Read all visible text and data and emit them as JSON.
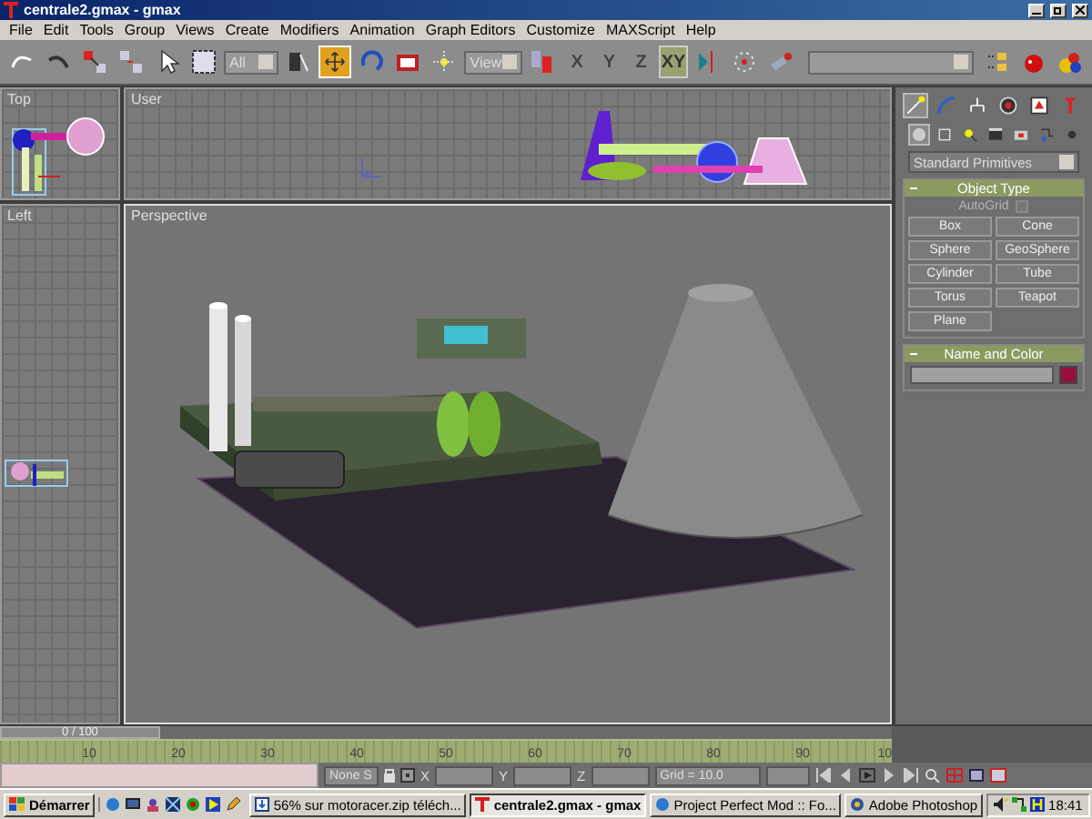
{
  "window": {
    "title": "centrale2.gmax - gmax"
  },
  "menu": [
    "File",
    "Edit",
    "Tools",
    "Group",
    "Views",
    "Create",
    "Modifiers",
    "Animation",
    "Graph Editors",
    "Customize",
    "MAXScript",
    "Help"
  ],
  "toolbar": {
    "selection_filter": "All",
    "transform_tools": [
      {
        "selected": true
      },
      {
        "selected": false
      },
      {
        "selected": false
      }
    ],
    "reference_coordinate": "View",
    "axis_buttons": [
      {
        "label": "X",
        "selected": false
      },
      {
        "label": "Y",
        "selected": false
      },
      {
        "label": "Z",
        "selected": false
      },
      {
        "label": "XY",
        "selected": true
      }
    ]
  },
  "viewports": [
    {
      "label": "Top",
      "kind": "top"
    },
    {
      "label": "User",
      "kind": "user"
    },
    {
      "label": "Left",
      "kind": "left"
    },
    {
      "label": "Perspective",
      "kind": "perspective"
    }
  ],
  "command_panel": {
    "tabs": [
      {
        "selected": true
      },
      {
        "selected": false
      },
      {
        "selected": false
      },
      {
        "selected": false
      },
      {
        "selected": false
      },
      {
        "selected": false
      }
    ],
    "categories": [
      {
        "selected": true
      },
      {
        "selected": false
      },
      {
        "selected": false
      },
      {
        "selected": false
      },
      {
        "selected": false
      },
      {
        "selected": false
      },
      {
        "selected": false
      }
    ],
    "object_category": "Standard Primitives",
    "object_type": {
      "title": "Object Type",
      "expanded": true,
      "autogrid": {
        "label": "AutoGrid",
        "checked": false,
        "disabled": true
      },
      "buttons": [
        "Box",
        "Cone",
        "Sphere",
        "GeoSphere",
        "Cylinder",
        "Tube",
        "Torus",
        "Teapot",
        "Plane"
      ]
    },
    "name_and_color": {
      "title": "Name and Color",
      "expanded": true,
      "color": "#990f3c"
    }
  },
  "timeline": {
    "slider": {
      "label": "0 / 100",
      "level": 0
    },
    "ruler_labels": [
      "10",
      "20",
      "30",
      "40",
      "50",
      "60",
      "70",
      "80",
      "90",
      "10"
    ]
  },
  "status_bar": {
    "selection": "None S",
    "axes": [
      "X",
      "Y",
      "Z"
    ],
    "grid": "Grid = 10.0"
  },
  "taskbar": {
    "start": "Démarrer",
    "tasks": [
      {
        "label": "56% sur motoracer.zip téléch...",
        "selected": false
      },
      {
        "label": "centrale2.gmax - gmax",
        "selected": true
      },
      {
        "label": "Project Perfect Mod :: Fo...",
        "selected": false
      },
      {
        "label": "Adobe Photoshop",
        "selected": false
      }
    ],
    "clock": "18:41"
  }
}
